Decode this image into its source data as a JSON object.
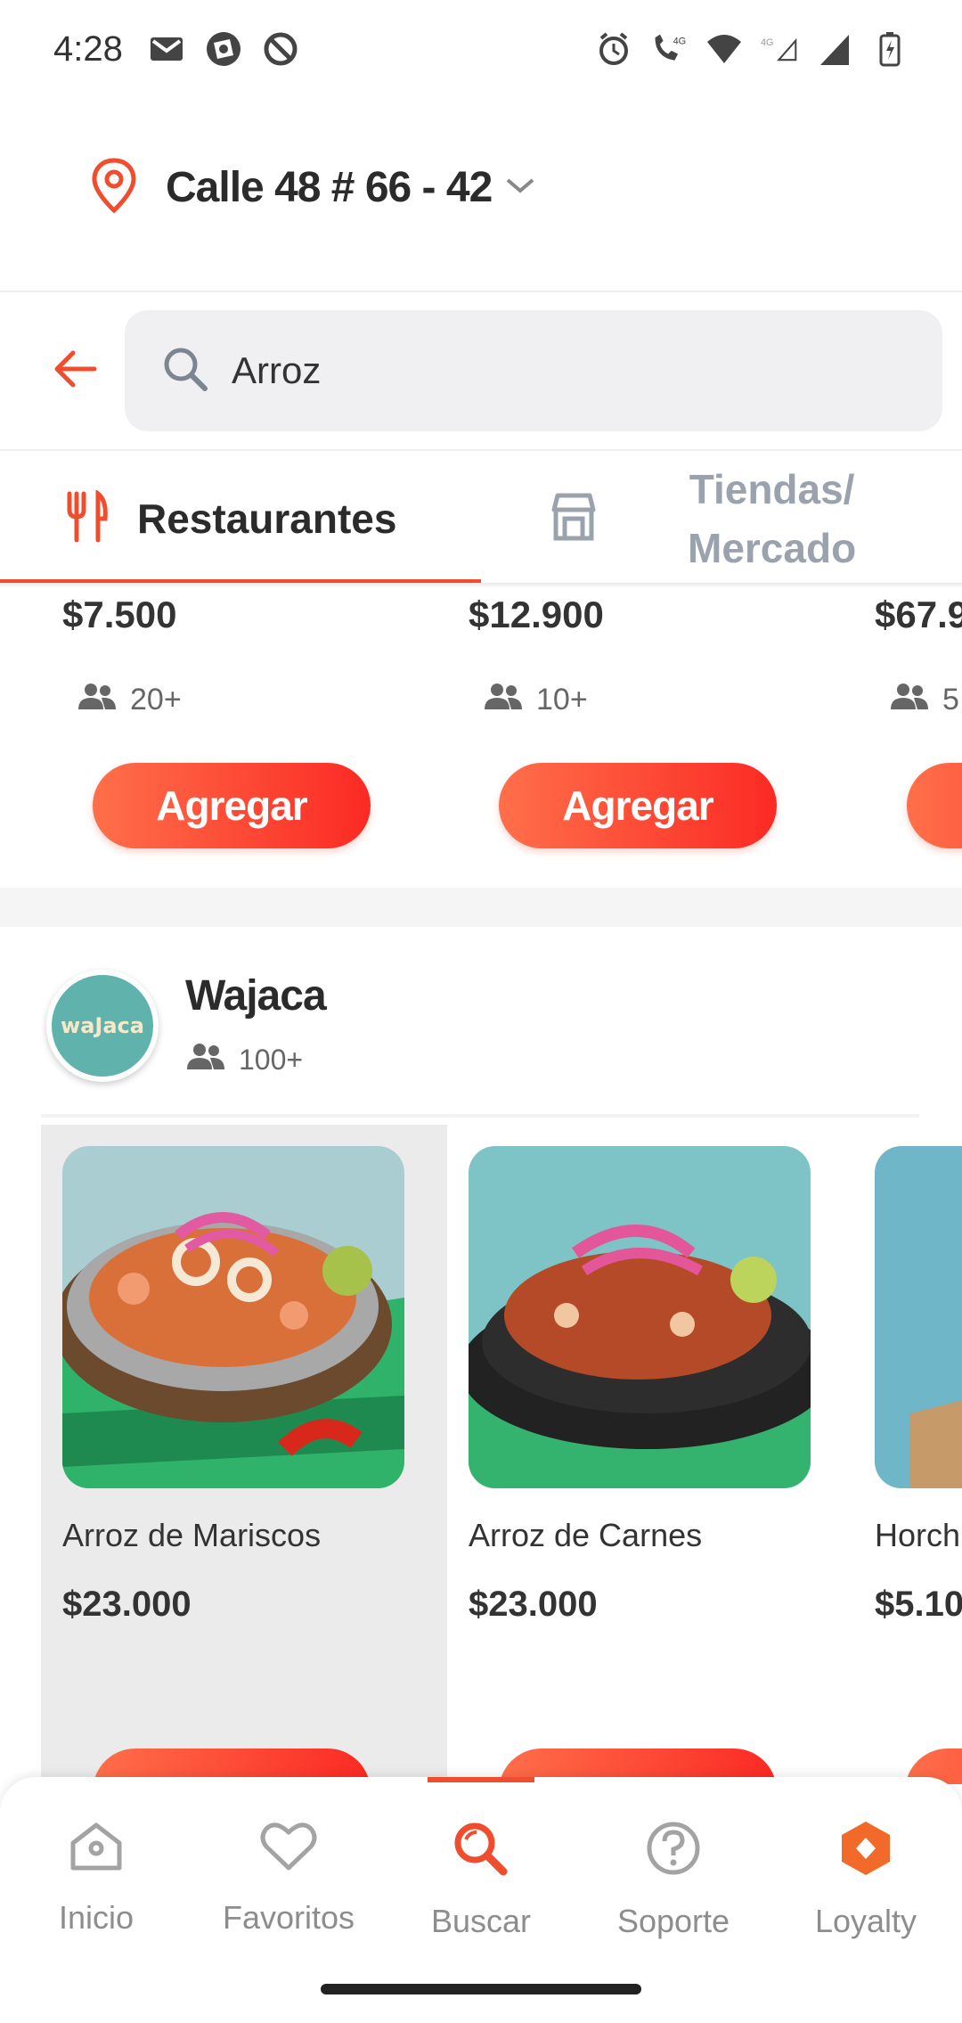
{
  "status_bar": {
    "time": "4:28"
  },
  "address": {
    "text": "Calle 48 # 66 - 42"
  },
  "search": {
    "value": "Arroz"
  },
  "tabs": [
    {
      "label": "Restaurantes",
      "active": true
    },
    {
      "label": "Tiendas/\nMercado",
      "active": false
    }
  ],
  "previous_row": {
    "items": [
      {
        "price": "$7.500",
        "popularity": "20+",
        "button": "Agregar"
      },
      {
        "price": "$12.900",
        "popularity": "10+",
        "button": "Agregar"
      },
      {
        "price": "$67.9",
        "popularity": "5"
      }
    ]
  },
  "store": {
    "name": "Wajaca",
    "logo_text": "waJaca",
    "popularity": "100+",
    "products": [
      {
        "name": "Arroz de Mariscos",
        "price": "$23.000"
      },
      {
        "name": "Arroz de Carnes",
        "price": "$23.000"
      },
      {
        "name": "Horch",
        "price": "$5.10"
      }
    ]
  },
  "bottom_nav": {
    "items": [
      {
        "label": "Inicio",
        "icon": "home-icon"
      },
      {
        "label": "Favoritos",
        "icon": "heart-icon"
      },
      {
        "label": "Buscar",
        "icon": "search-icon",
        "active": true
      },
      {
        "label": "Soporte",
        "icon": "help-icon"
      },
      {
        "label": "Loyalty",
        "icon": "loyalty-icon"
      }
    ]
  },
  "colors": {
    "accent": "#f04c2e",
    "button_gradient_start": "#ff6f4a",
    "button_gradient_end": "#fb2a24",
    "inactive_tab": "#9aa3ad"
  }
}
